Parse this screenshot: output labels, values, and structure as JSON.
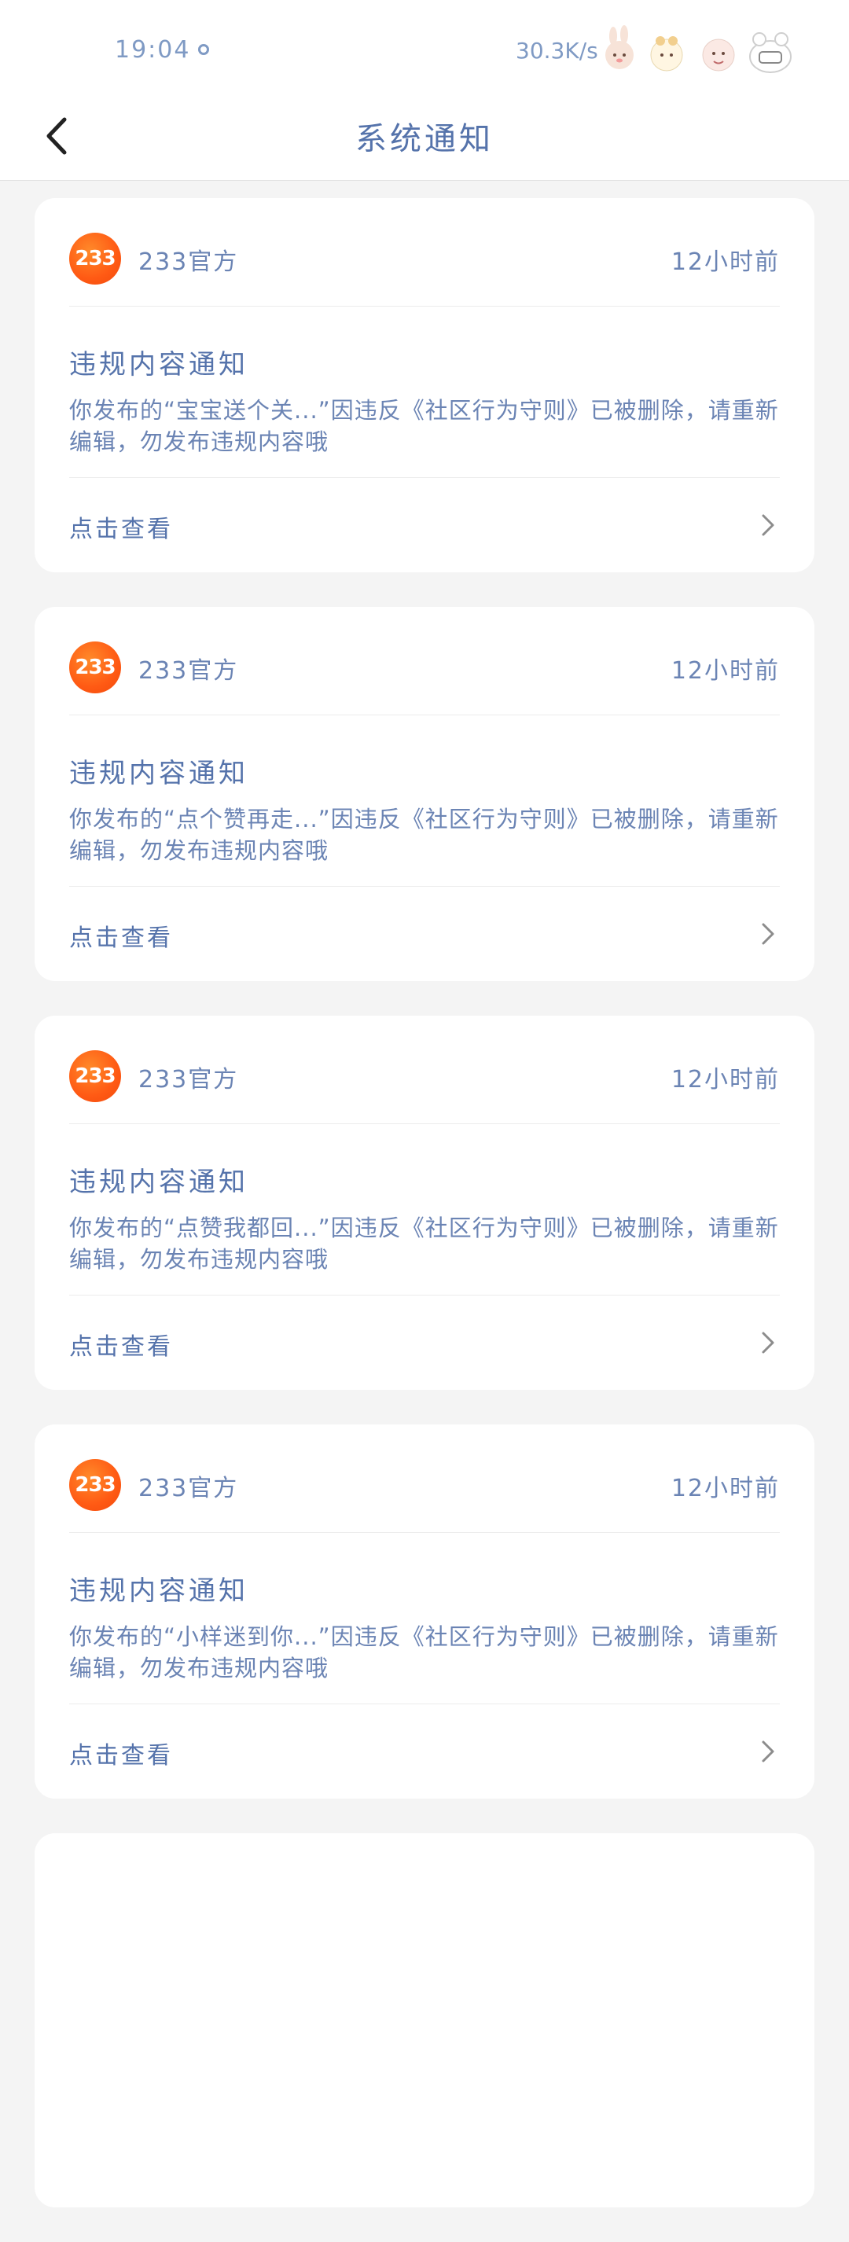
{
  "status_bar": {
    "time": "19:04",
    "speed": "30.3K/s"
  },
  "header": {
    "title": "系统通知",
    "back_icon": "chevron-left-icon"
  },
  "notices": [
    {
      "logo_text": "233",
      "sender": "233官方",
      "time": "12小时前",
      "title": "违规内容通知",
      "content": "你发布的“宝宝送个关...”因违反《社区行为守则》已被删除，请重新编辑，勿发布违规内容哦",
      "action": "点击查看"
    },
    {
      "logo_text": "233",
      "sender": "233官方",
      "time": "12小时前",
      "title": "违规内容通知",
      "content": "你发布的“点个赞再走...”因违反《社区行为守则》已被删除，请重新编辑，勿发布违规内容哦",
      "action": "点击查看"
    },
    {
      "logo_text": "233",
      "sender": "233官方",
      "time": "12小时前",
      "title": "违规内容通知",
      "content": "你发布的“点赞我都回...”因违反《社区行为守则》已被删除，请重新编辑，勿发布违规内容哦",
      "action": "点击查看"
    },
    {
      "logo_text": "233",
      "sender": "233官方",
      "time": "12小时前",
      "title": "违规内容通知",
      "content": "你发布的“小样迷到你...”因违反《社区行为守则》已被删除，请重新编辑，勿发布违规内容哦",
      "action": "点击查看"
    }
  ],
  "colors": {
    "text_blue": "#5573ab",
    "logo_orange": "#ff5a14",
    "background": "#f4f4f4"
  }
}
